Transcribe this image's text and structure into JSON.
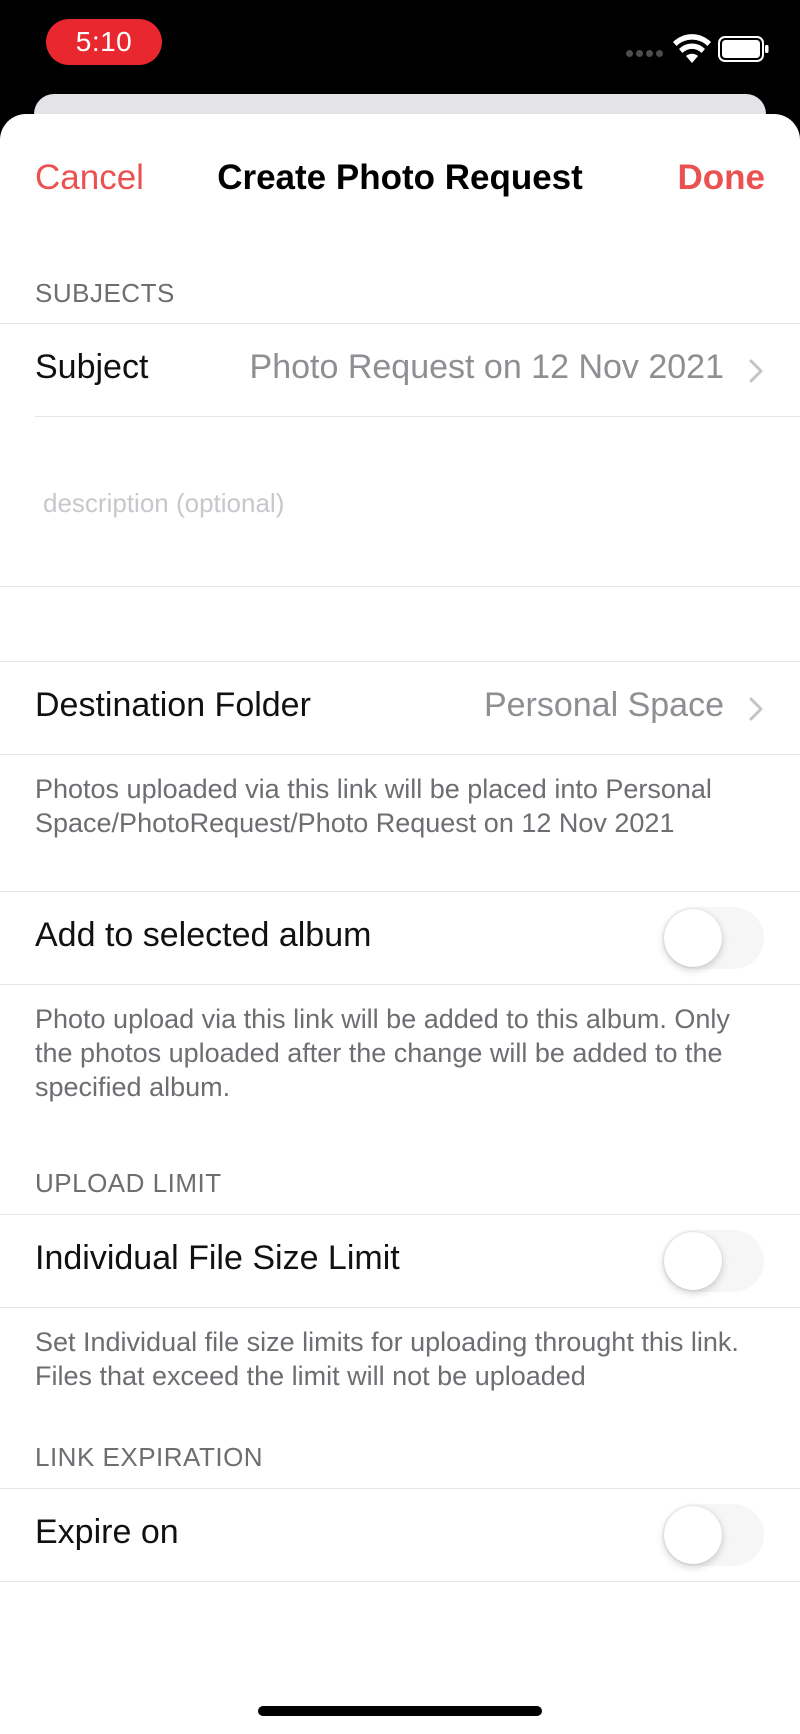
{
  "status_bar": {
    "time": "5:10"
  },
  "nav": {
    "cancel_label": "Cancel",
    "title": "Create Photo Request",
    "done_label": "Done"
  },
  "subjects": {
    "header": "SUBJECTS",
    "subject_label": "Subject",
    "subject_value": "Photo Request on 12 Nov 2021",
    "description_placeholder": "description (optional)"
  },
  "destination": {
    "label": "Destination Folder",
    "value": "Personal Space",
    "footer": "Photos uploaded via this link will be placed into Personal Space/PhotoRequest/Photo Request on 12 Nov 2021"
  },
  "album": {
    "label": "Add to selected album",
    "enabled": false,
    "footer": "Photo upload via this link will be added to this album. Only the photos uploaded after the change will be added to the specified album."
  },
  "upload_limit": {
    "header": "UPLOAD LIMIT",
    "label": "Individual File Size Limit",
    "enabled": false,
    "footer": "Set Individual file size limits for uploading throught this link. Files that exceed the limit will not be uploaded"
  },
  "link_expiration": {
    "header": "LINK EXPIRATION",
    "label": "Expire on",
    "enabled": false
  },
  "colors": {
    "accent": "#ea5252",
    "time_pill": "#e8282e",
    "secondary_text": "#8e8e93"
  }
}
